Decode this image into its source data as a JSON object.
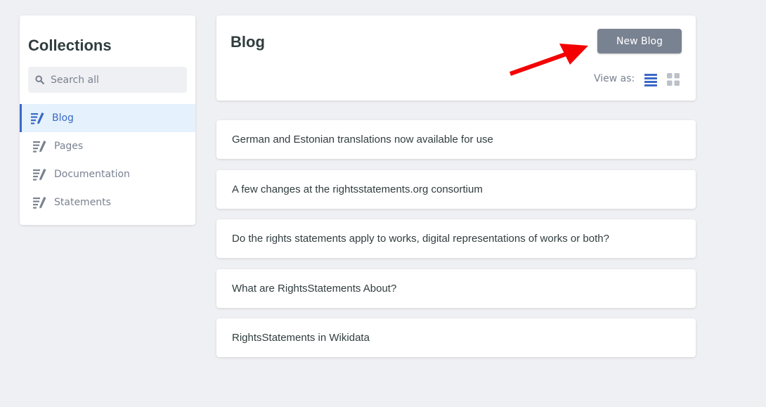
{
  "sidebar": {
    "title": "Collections",
    "search_placeholder": "Search all",
    "items": [
      {
        "label": "Blog",
        "active": true
      },
      {
        "label": "Pages",
        "active": false
      },
      {
        "label": "Documentation",
        "active": false
      },
      {
        "label": "Statements",
        "active": false
      }
    ]
  },
  "header": {
    "title": "Blog",
    "new_button_label": "New Blog",
    "view_as_label": "View as:",
    "view_modes": [
      "list-view-icon",
      "grid-view-icon"
    ],
    "active_view": "list"
  },
  "entries": [
    "German and Estonian translations now available for use",
    "A few changes at the rightsstatements.org consortium",
    "Do the rights statements apply to works, digital representations of works or both?",
    "What are RightsStatements About?",
    "RightsStatements in Wikidata"
  ],
  "colors": {
    "accent": "#3a69c7",
    "background": "#eff0f3",
    "button": "#798291",
    "annotation_arrow": "#f50000"
  }
}
